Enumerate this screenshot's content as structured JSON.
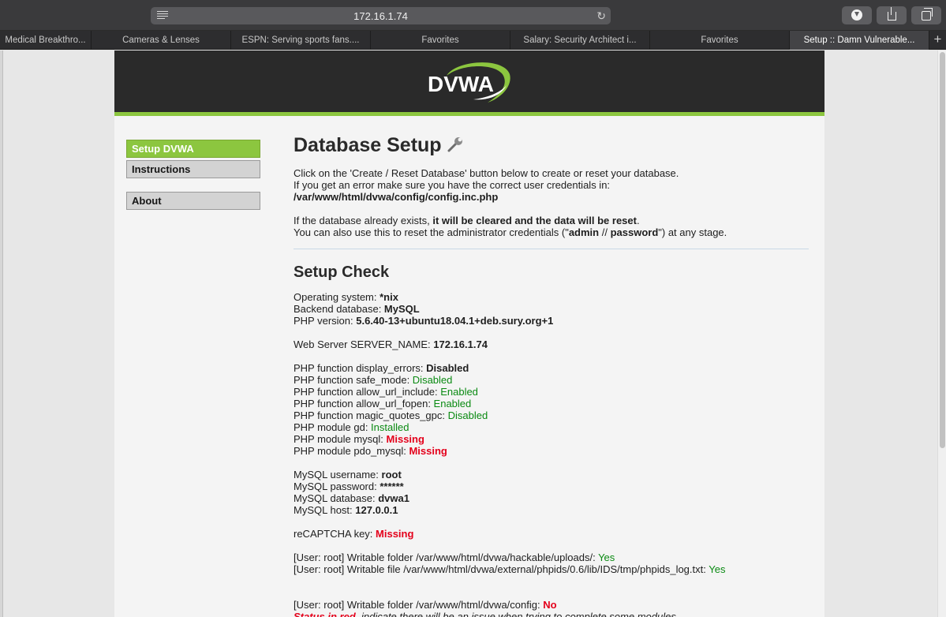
{
  "browser": {
    "url": "172.16.1.74",
    "tabs": [
      "Medical Breakthro...",
      "Cameras & Lenses",
      "ESPN: Serving sports fans....",
      "Favorites",
      "Salary: Security Architect i...",
      "Favorites",
      "Setup :: Damn Vulnerable..."
    ],
    "new_tab_label": "+"
  },
  "site": {
    "logo_text": "DVWA",
    "brand_color": "#8cc63f"
  },
  "menu": {
    "items": [
      "Setup DVWA",
      "Instructions"
    ],
    "about": "About"
  },
  "main": {
    "title": "Database Setup",
    "intro1": "Click on the 'Create / Reset Database' button below to create or reset your database.",
    "intro2": "If you get an error make sure you have the correct user credentials in:",
    "config_path": "/var/www/html/dvwa/config/config.inc.php",
    "exists_pre": "If the database already exists, ",
    "exists_bold": "it will be cleared and the data will be reset",
    "exists_post": ".",
    "reset_pre": "You can also use this to reset the administrator credentials (\"",
    "reset_admin": "admin",
    "reset_mid": " // ",
    "reset_pass": "password",
    "reset_post": "\") at any stage."
  },
  "check": {
    "title": "Setup Check",
    "os_label": "Operating system: ",
    "os_value": "*nix",
    "db_label": "Backend database: ",
    "db_value": "MySQL",
    "php_label": "PHP version: ",
    "php_value": "5.6.40-13+ubuntu18.04.1+deb.sury.org+1",
    "server_label": "Web Server SERVER_NAME: ",
    "server_value": "172.16.1.74",
    "display_errors_label": "PHP function display_errors: ",
    "display_errors_value": "Disabled",
    "safe_mode_label": "PHP function safe_mode: ",
    "safe_mode_value": "Disabled",
    "url_include_label": "PHP function allow_url_include: ",
    "url_include_value": "Enabled",
    "url_fopen_label": "PHP function allow_url_fopen: ",
    "url_fopen_value": "Enabled",
    "magic_quotes_label": "PHP function magic_quotes_gpc: ",
    "magic_quotes_value": "Disabled",
    "gd_label": "PHP module gd: ",
    "gd_value": "Installed",
    "mysql_label": "PHP module mysql: ",
    "mysql_value": "Missing",
    "pdo_label": "PHP module pdo_mysql: ",
    "pdo_value": "Missing",
    "mysql_user_label": "MySQL username: ",
    "mysql_user_value": "root",
    "mysql_pass_label": "MySQL password: ",
    "mysql_pass_value": "******",
    "mysql_db_label": "MySQL database: ",
    "mysql_db_value": "dvwa1",
    "mysql_host_label": "MySQL host: ",
    "mysql_host_value": "127.0.0.1",
    "recaptcha_label": "reCAPTCHA key: ",
    "recaptcha_value": "Missing",
    "uploads_label": "[User: root] Writable folder /var/www/html/dvwa/hackable/uploads/: ",
    "uploads_value": "Yes",
    "phpids_label": "[User: root] Writable file /var/www/html/dvwa/external/phpids/0.6/lib/IDS/tmp/phpids_log.txt: ",
    "phpids_value": "Yes",
    "config_label": "[User: root] Writable folder /var/www/html/dvwa/config: ",
    "config_value": "No",
    "status_red": "Status in red",
    "status_rest": ", indicate there will be an issue when trying to complete some modules."
  }
}
